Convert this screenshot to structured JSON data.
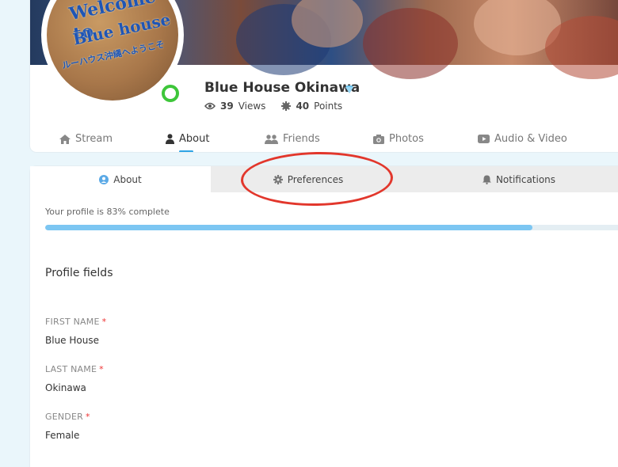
{
  "profile": {
    "name": "Blue House Okinawa",
    "views_count": "39",
    "views_label": "Views",
    "points_count": "40",
    "points_label": "Points",
    "avatar_sign_lines": [
      "Welcome to",
      "Blue house",
      "ルーハウス沖縄へようこそ"
    ]
  },
  "nav": {
    "items": [
      {
        "label": "Stream",
        "icon": "home-icon"
      },
      {
        "label": "About",
        "icon": "user-icon"
      },
      {
        "label": "Friends",
        "icon": "users-icon"
      },
      {
        "label": "Photos",
        "icon": "camera-icon"
      },
      {
        "label": "Audio & Video",
        "icon": "play-icon"
      }
    ],
    "active": "About"
  },
  "tabs": {
    "items": [
      {
        "label": "About",
        "icon": "user-circle-icon"
      },
      {
        "label": "Preferences",
        "icon": "gear-icon"
      },
      {
        "label": "Notifications",
        "icon": "bell-icon"
      }
    ],
    "active": "About"
  },
  "profile_completion": {
    "text": "Your profile is 83% complete",
    "percent": 83
  },
  "profile_fields": {
    "title": "Profile fields",
    "fields": [
      {
        "label": "FIRST NAME",
        "required": "*",
        "value": "Blue House"
      },
      {
        "label": "LAST NAME",
        "required": "*",
        "value": "Okinawa"
      },
      {
        "label": "GENDER",
        "required": "*",
        "value": "Female"
      }
    ]
  },
  "colors": {
    "accent": "#2ea4e5",
    "progress": "#7cc6f2",
    "online": "#3ec63a",
    "annotation": "#e2372c",
    "required": "#ee3333"
  }
}
